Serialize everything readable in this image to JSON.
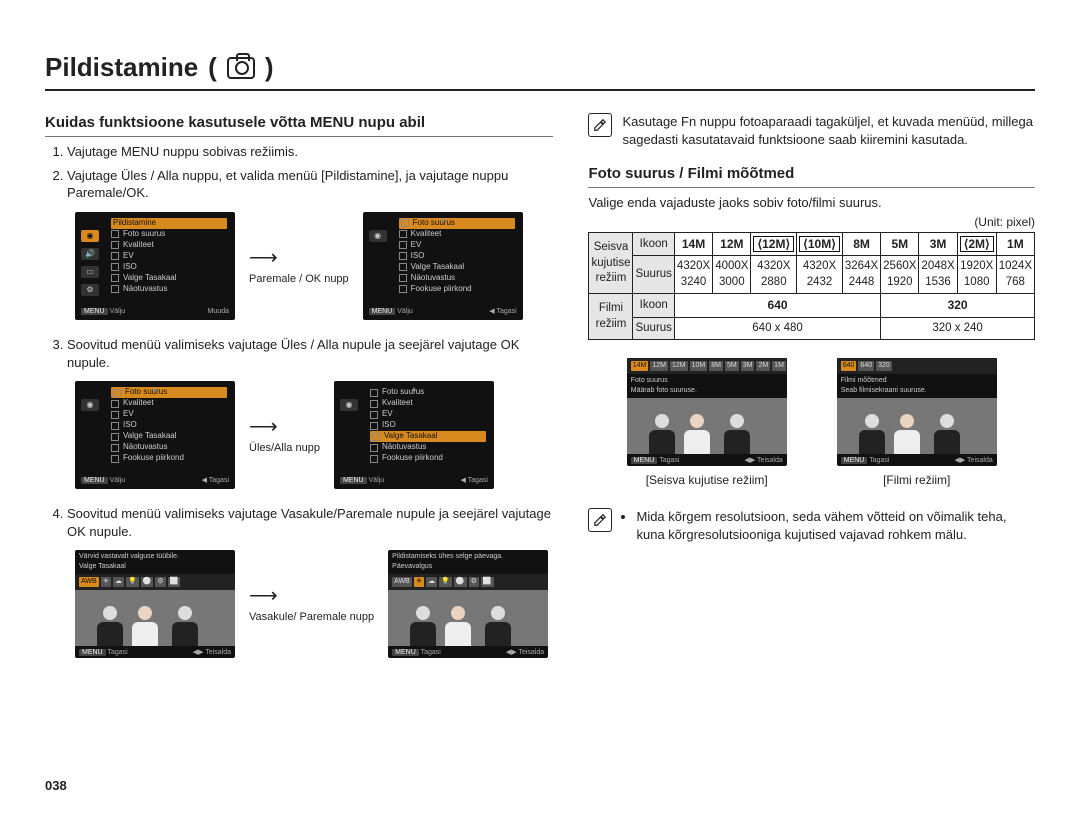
{
  "page_number": "038",
  "title": "Pildistamine",
  "title_parens_open": "(",
  "title_parens_close": ")",
  "left": {
    "heading": "Kuidas funktsioone kasutusele võtta MENU nupu abil",
    "step1": "Vajutage MENU nuppu sobivas režiimis.",
    "step2": "Vajutage Üles / Alla nuppu, et valida menüü [Pildistamine], ja vajutage nuppu Paremale/OK.",
    "step3": "Soovitud menüü valimiseks vajutage Üles / Alla nupule ja seejärel vajutage OK nupule.",
    "step4": "Soovitud menüü valimiseks vajutage Vasakule/Paremale nupule ja seejärel vajutage OK nupule.",
    "lcd_tabs": [
      "Pildistamine",
      "Heli",
      "Ekraan",
      "Sätted"
    ],
    "lcd_menu": [
      "Foto suurus",
      "Kvaliteet",
      "EV",
      "ISO",
      "Valge Tasakaal",
      "Näotuvastus",
      "Fookuse piirkond"
    ],
    "lcd_footer_exit_key": "MENU",
    "lcd_footer_exit": "Välju",
    "lcd_footer_move": "Muuda",
    "lcd_footer_back": "Tagasi",
    "arrow1": "Paremale / OK nupp",
    "arrow2": "Üles/Alla nupp",
    "arrow3": "Vasakule/ Paremale nupp",
    "lcd4_line1": "Värvid vastavalt valguse tüübile.",
    "lcd4_line2": "Valge Tasakaal",
    "lcd4_footer": "Teisalda",
    "lcd5_line1": "Pildistamiseks ühes selge päevaga.",
    "lcd5_line2": "Päevavalgus",
    "lcd5_footer": "Teisalda",
    "wb_icons": [
      "AWB",
      "☀",
      "☁",
      "💡",
      "⚪",
      "⚙",
      "⬜"
    ]
  },
  "right": {
    "note1": "Kasutage Fn nuppu fotoaparaadi tagaküljel, et kuvada menüüd, millega sagedasti kasutatavaid funktsioone saab kiiremini kasutada.",
    "heading": "Foto suurus / Filmi mõõtmed",
    "subtext": "Valige enda vajaduste jaoks sobiv foto/filmi suurus.",
    "unit_label": "(Unit: pixel)",
    "row_still": "Seisva kujutise režiim",
    "row_movie": "Filmi režiim",
    "col_icon": "Ikoon",
    "col_size": "Suurus",
    "still_icons": [
      "14M",
      "12M",
      "⟨12M⟩",
      "⟨10M⟩",
      "8M",
      "5M",
      "3M",
      "⟨2M⟩",
      "1M"
    ],
    "still_sizes_top": [
      "4320X",
      "4000X",
      "4320X",
      "4320X",
      "3264X",
      "2560X",
      "2048X",
      "1920X",
      "1024X"
    ],
    "still_sizes_bot": [
      "3240",
      "3000",
      "2880",
      "2432",
      "2448",
      "1920",
      "1536",
      "1080",
      "768"
    ],
    "movie_icons": [
      "640",
      "320"
    ],
    "movie_sizes": [
      "640 x 480",
      "320 x 240"
    ],
    "preview1_chips": [
      "14M",
      "12M",
      "12M",
      "10M",
      "8M",
      "5M",
      "3M",
      "2M",
      "1M"
    ],
    "preview1_line1": "Foto suurus",
    "preview1_line2": "Määrab foto suuruse.",
    "preview1_caption": "[Seisva kujutise režiim]",
    "preview2_chips": [
      "640",
      "640",
      "320"
    ],
    "preview2_line1": "Filmi mõõtmed",
    "preview2_line2": "Seab filmisekraani suuruse.",
    "preview2_caption": "[Filmi režiim]",
    "preview_footer_back": "Tagasi",
    "preview_footer_move": "Teisalda",
    "note2": "Mida kõrgem resolutsioon, seda vähem võtteid on võimalik teha, kuna kõrgresolutsiooniga kujutised vajavad rohkem mälu."
  }
}
